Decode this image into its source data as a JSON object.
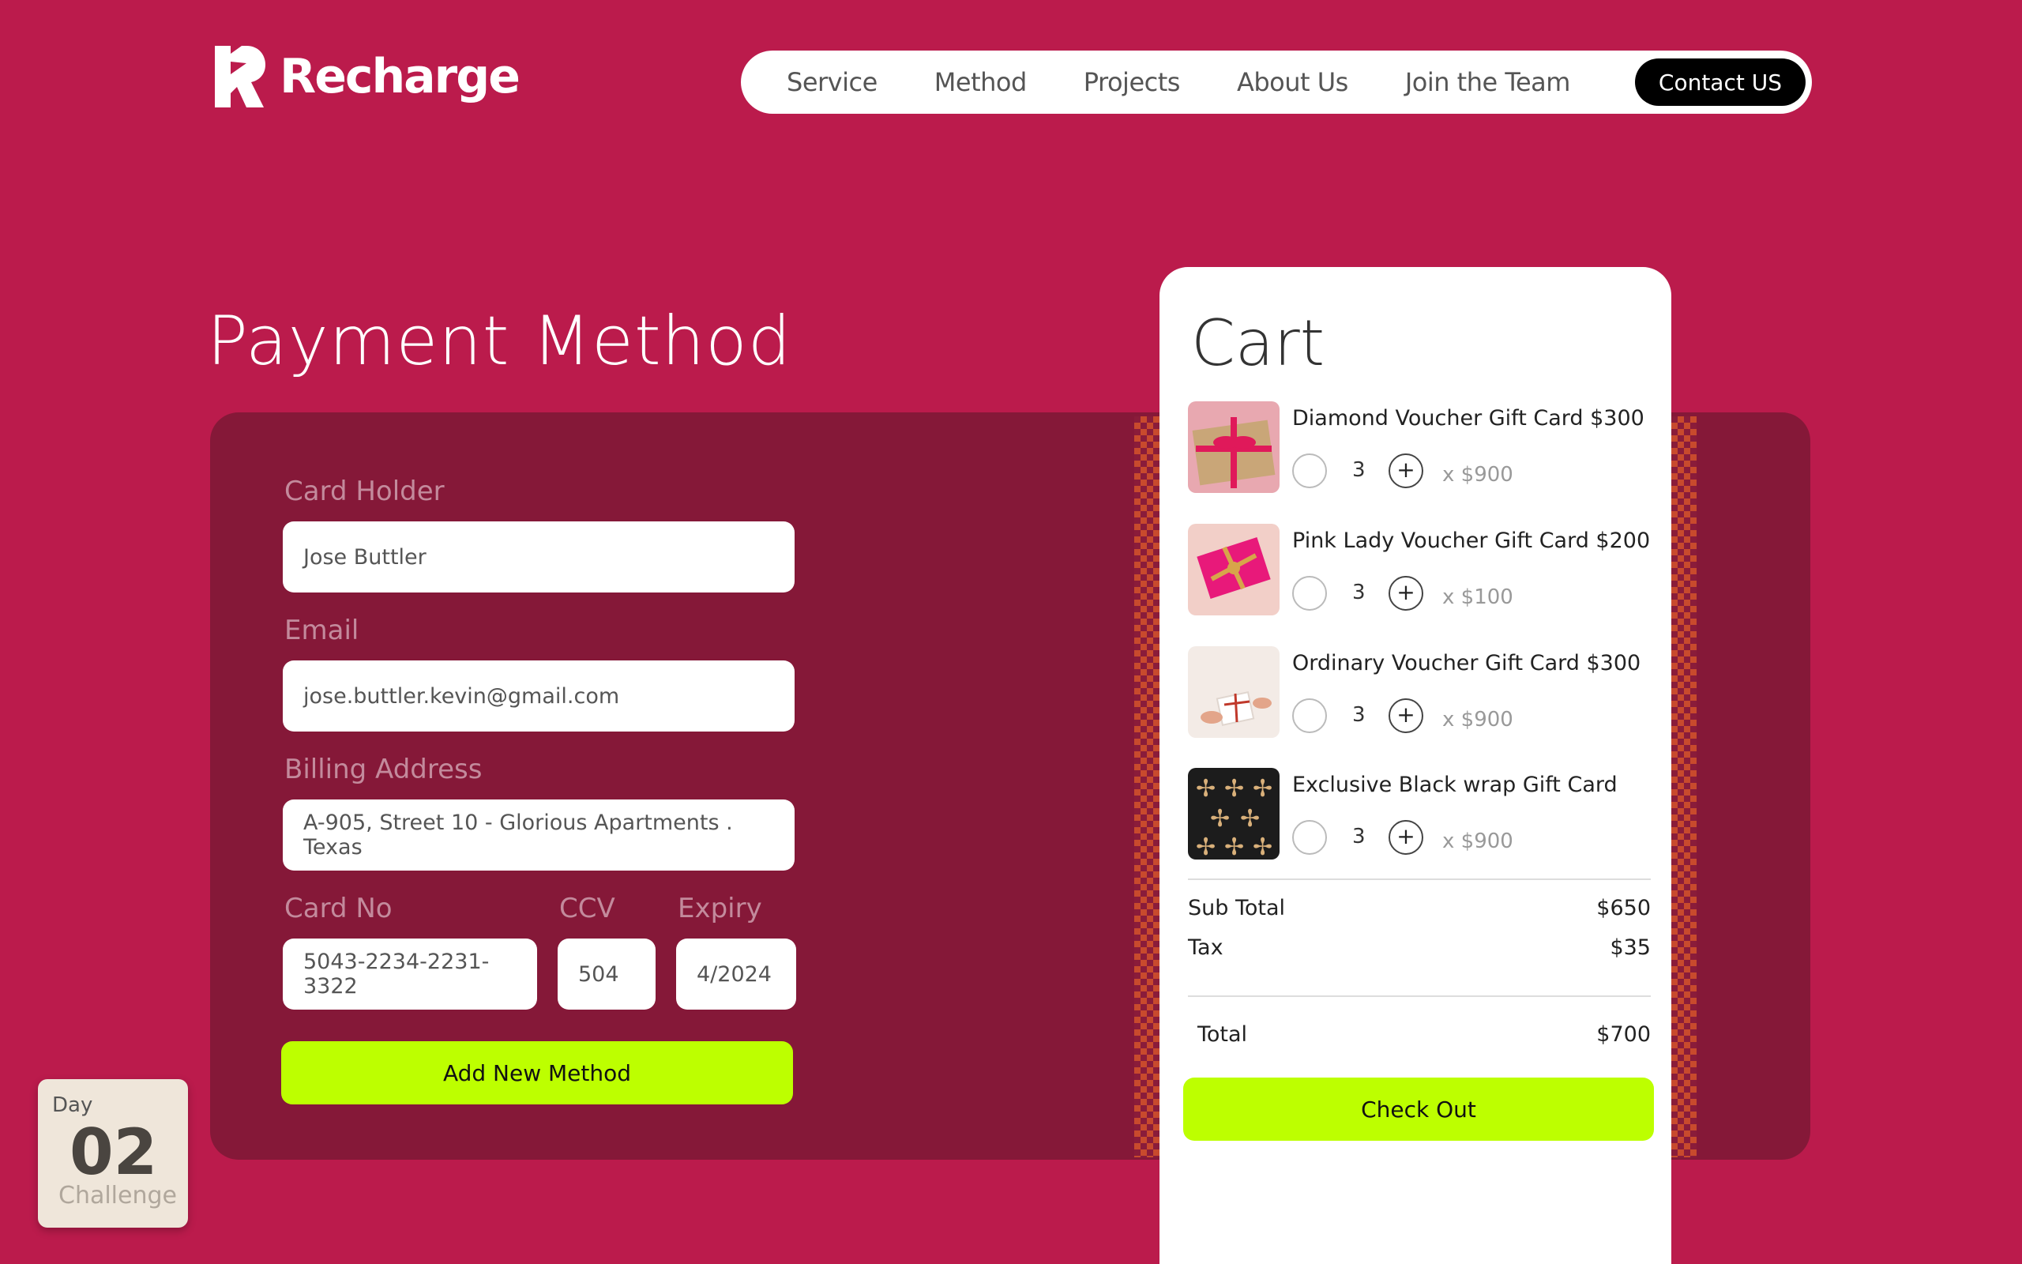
{
  "brand": {
    "name": "Recharge"
  },
  "nav": {
    "items": [
      "Service",
      "Method",
      "Projects",
      "About Us",
      "Join the Team"
    ],
    "contact_label": "Contact US"
  },
  "page": {
    "title": "Payment Method"
  },
  "form": {
    "card_holder": {
      "label": "Card Holder",
      "value": "Jose Buttler"
    },
    "email": {
      "label": "Email",
      "value": "jose.buttler.kevin@gmail.com"
    },
    "billing": {
      "label": "Billing Address",
      "value": "A-905, Street 10 - Glorious Apartments . Texas"
    },
    "card_no": {
      "label": "Card No",
      "value": "5043-2234-2231-3322"
    },
    "ccv": {
      "label": "CCV",
      "value": "504"
    },
    "expiry": {
      "label": "Expiry",
      "value": "4/2024"
    },
    "add_button": "Add New Method"
  },
  "cart": {
    "title": "Cart",
    "items": [
      {
        "name": "Diamond Voucher Gift Card $300",
        "qty": "3",
        "price": "x $900"
      },
      {
        "name": "Pink Lady Voucher Gift Card $200",
        "qty": "3",
        "price": "x $100"
      },
      {
        "name": "Ordinary Voucher Gift Card $300",
        "qty": "3",
        "price": "x $900"
      },
      {
        "name": "Exclusive Black wrap Gift Card",
        "qty": "3",
        "price": "x $900"
      }
    ],
    "subtotal_label": "Sub Total",
    "subtotal": "$650",
    "tax_label": "Tax",
    "tax": "$35",
    "total_label": "Total",
    "total": "$700",
    "checkout": "Check Out"
  },
  "badge": {
    "label": "Day",
    "number": "02",
    "sub": "Challenge"
  },
  "colors": {
    "background": "#bb1b4c",
    "panel": "#851838",
    "accent": "#bdff00"
  }
}
